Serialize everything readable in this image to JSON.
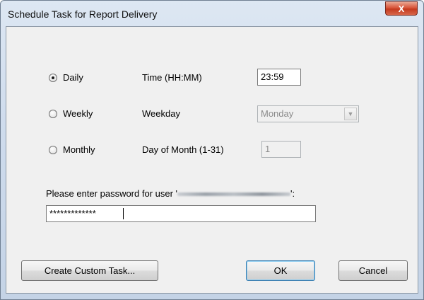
{
  "window": {
    "title": "Schedule Task for Report Delivery",
    "close_glyph": "X"
  },
  "schedule": {
    "options": [
      {
        "label": "Daily",
        "checked": true
      },
      {
        "label": "Weekly",
        "checked": false
      },
      {
        "label": "Monthly",
        "checked": false
      }
    ],
    "time_label": "Time (HH:MM)",
    "time_value": "23:59",
    "weekday_label": "Weekday",
    "weekday_value": "Monday",
    "day_label": "Day of Month (1-31)",
    "day_value": "1"
  },
  "password": {
    "prompt_prefix": "Please enter password for user '",
    "prompt_suffix": "':",
    "value": "*************"
  },
  "buttons": {
    "custom_task": "Create Custom Task...",
    "ok": "OK",
    "cancel": "Cancel"
  },
  "icons": {
    "close": "close-icon",
    "dropdown": "chevron-down-icon",
    "radio_checked": "radio-checked-icon",
    "radio_unchecked": "radio-unchecked-icon"
  }
}
